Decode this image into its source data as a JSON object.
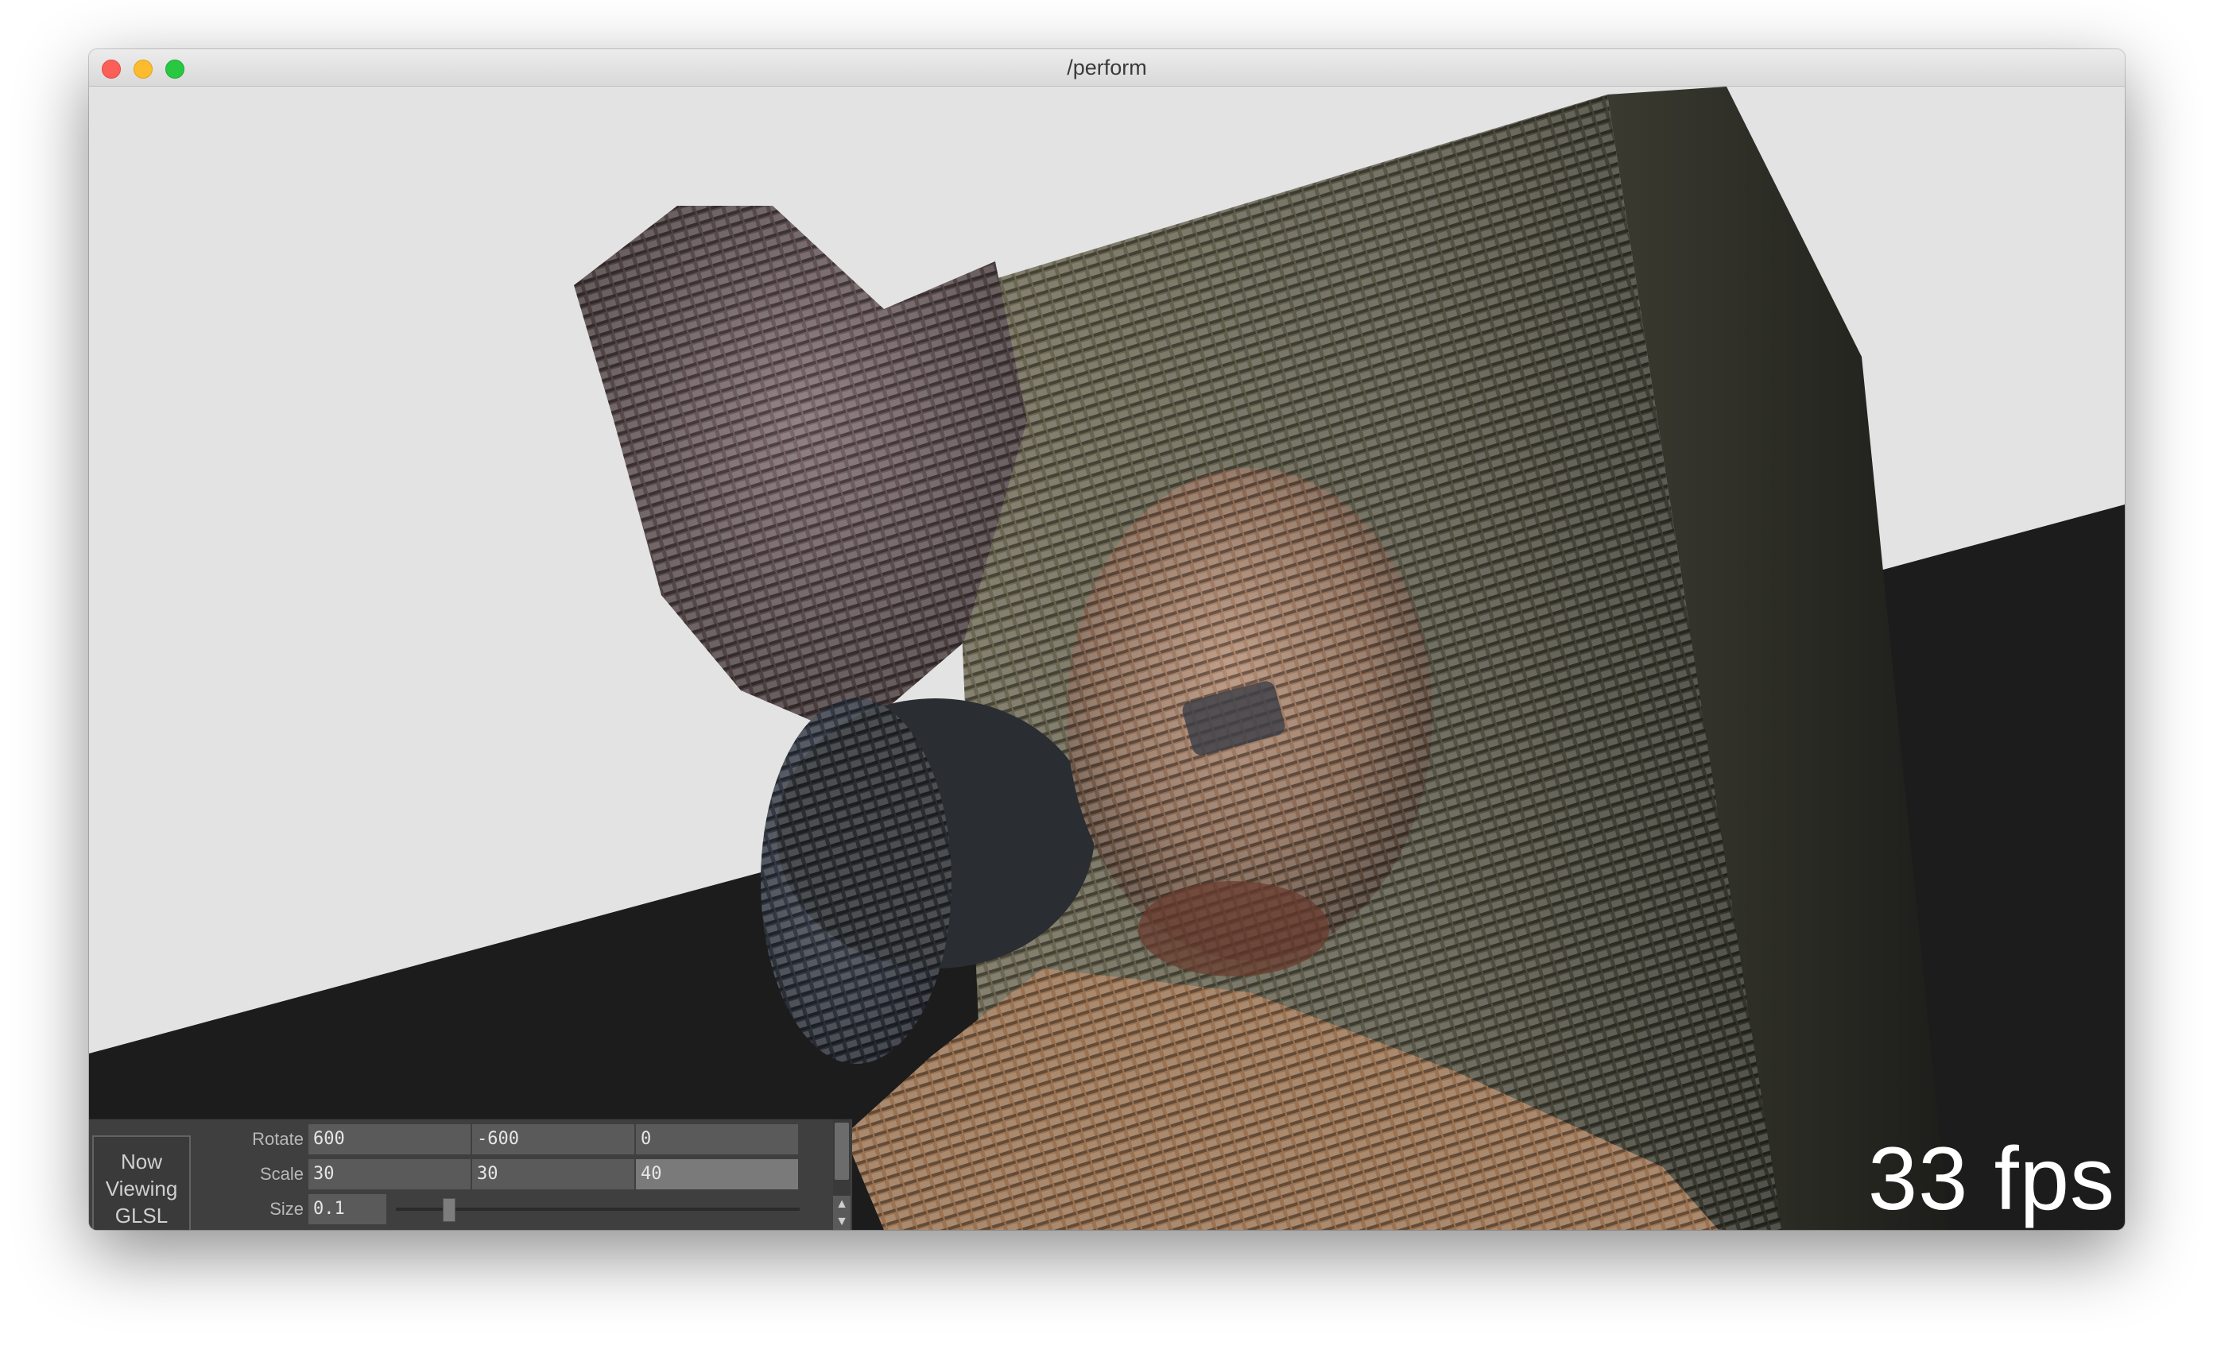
{
  "window": {
    "title": "/perform"
  },
  "viewport": {
    "fps_text": "33 fps",
    "background_color": "#e3e3e3",
    "floor_color": "#1c1c1c"
  },
  "panel": {
    "viewing_lines": [
      "Now",
      "Viewing",
      "GLSL"
    ],
    "rotate": {
      "label": "Rotate",
      "values": [
        "600",
        "-600",
        "0"
      ]
    },
    "scale": {
      "label": "Scale",
      "values": [
        "30",
        "30",
        "40"
      ]
    },
    "size": {
      "label": "Size",
      "value": "0.1",
      "slider_fraction": 0.12
    }
  }
}
